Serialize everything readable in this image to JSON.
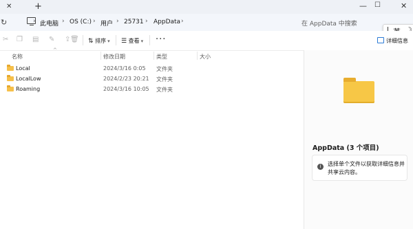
{
  "titlebar": {
    "close_icon": "close-icon",
    "new_tab_icon": "plus-icon",
    "controls": [
      "minimize-icon",
      "maximize-icon",
      "close-window-icon"
    ]
  },
  "address": {
    "crumbs": [
      "此电脑",
      "OS (C:)",
      "用户",
      "25731",
      "AppData"
    ],
    "search_placeholder": "在 AppData 中搜索"
  },
  "ime": {
    "lang": "英"
  },
  "toolbar": {
    "sort_label": "排序",
    "view_label": "查看",
    "more_label": "···",
    "details_label": "详细信息"
  },
  "columns": {
    "name": "名称",
    "modified": "修改日期",
    "type": "类型",
    "size": "大小"
  },
  "files": [
    {
      "name": "Local",
      "modified": "2024/3/16 0:05",
      "type": "文件夹"
    },
    {
      "name": "LocalLow",
      "modified": "2024/2/23 20:21",
      "type": "文件夹"
    },
    {
      "name": "Roaming",
      "modified": "2024/3/16 10:05",
      "type": "文件夹"
    }
  ],
  "preview": {
    "title": "AppData (3 个项目)",
    "info_text": "选择单个文件以获取详细信息并共享云内容。"
  },
  "colors": {
    "folder": "#f6c04a",
    "accent": "#2a7ad5"
  }
}
